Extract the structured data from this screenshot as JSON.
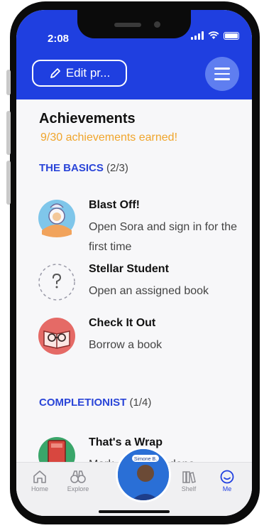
{
  "status": {
    "time": "2:08"
  },
  "header": {
    "edit_label": "Edit pr..."
  },
  "achievements": {
    "title": "Achievements",
    "earned": "9/30 achievements earned!",
    "sections": [
      {
        "name": "THE BASICS",
        "count": "(2/3)",
        "items": [
          {
            "name": "Blast Off!",
            "desc": "Open Sora and sign in for the first time",
            "icon": "astronaut-badge-icon"
          },
          {
            "name": "Stellar Student",
            "desc": "Open an assigned book",
            "icon": "question-mark-icon"
          },
          {
            "name": "Check It Out",
            "desc": "Borrow a book",
            "icon": "book-glasses-icon"
          }
        ]
      },
      {
        "name": "COMPLETIONIST",
        "count": "(1/4)",
        "items": [
          {
            "name": "That's a Wrap",
            "desc": "Mark a book as done",
            "icon": "red-book-icon"
          }
        ]
      }
    ]
  },
  "tabs": [
    {
      "label": "Home",
      "icon": "home-icon"
    },
    {
      "label": "Explore",
      "icon": "binoculars-icon"
    },
    {
      "label": "Shelf",
      "icon": "books-icon"
    },
    {
      "label": "Me",
      "icon": "smiley-icon"
    }
  ],
  "avatar": {
    "label": "Simone B."
  },
  "colors": {
    "brand": "#1f3fe0",
    "accent": "#f0a52c",
    "section": "#2a45d8"
  }
}
